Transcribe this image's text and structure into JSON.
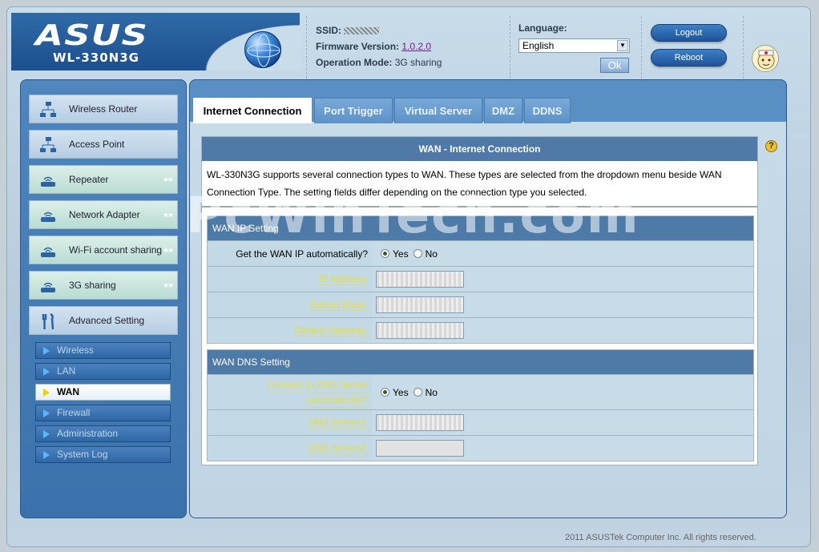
{
  "header": {
    "brand": "ASUS",
    "model": "WL-330N3G",
    "ssid_label": "SSID:",
    "ssid_value": "",
    "firmware_label": "Firmware Version:",
    "firmware_value": "1.0.2.0",
    "opmode_label": "Operation Mode:",
    "opmode_value": "3G sharing",
    "language_label": "Language:",
    "language_value": "English",
    "ok_label": "Ok",
    "logout_label": "Logout",
    "reboot_label": "Reboot"
  },
  "sidebar": {
    "items": [
      {
        "label": "Wireless Router"
      },
      {
        "label": "Access Point"
      },
      {
        "label": "Repeater"
      },
      {
        "label": "Network Adapter"
      },
      {
        "label": "Wi-Fi account sharing"
      },
      {
        "label": "3G sharing"
      },
      {
        "label": "Advanced Setting"
      }
    ],
    "sub_items": [
      {
        "label": "Wireless"
      },
      {
        "label": "LAN"
      },
      {
        "label": "WAN"
      },
      {
        "label": "Firewall"
      },
      {
        "label": "Administration"
      },
      {
        "label": "System Log"
      }
    ]
  },
  "tabs": [
    {
      "label": "Internet Connection"
    },
    {
      "label": "Port Trigger"
    },
    {
      "label": "Virtual Server"
    },
    {
      "label": "DMZ"
    },
    {
      "label": "DDNS"
    }
  ],
  "content": {
    "title": "WAN - Internet Connection",
    "description": "WL-330N3G supports several connection types to WAN. These types are selected from the dropdown menu beside WAN Connection Type. The setting fields differ depending on the connection type you selected.",
    "ip_section": {
      "title": "WAN IP Setting",
      "auto_label": "Get the WAN IP automatically?",
      "yes": "Yes",
      "no": "No",
      "ip_label": "IP Address:",
      "mask_label": "Subnet Mask:",
      "gateway_label": "Default Gateway:"
    },
    "dns_section": {
      "title": "WAN DNS Setting",
      "auto_label_1": "Connect to DNS Server",
      "auto_label_2": "automatically?",
      "yes": "Yes",
      "no": "No",
      "dns1_label": "DNS Server1:",
      "dns2_label": "DNS Server2:"
    }
  },
  "footer": "2011 ASUSTek Computer Inc. All rights reserved.",
  "watermark": "PcWinTech.com"
}
